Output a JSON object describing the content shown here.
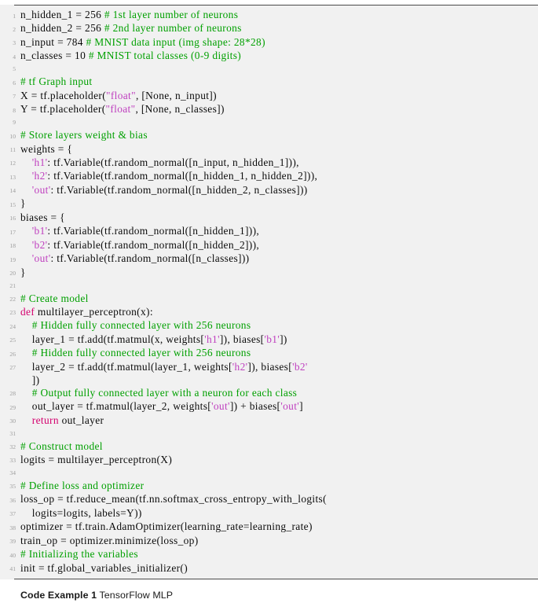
{
  "figure": {
    "kind": "code-listing",
    "language": "python",
    "background_color": "#f1f1f1",
    "rule_color": "#4a4a4a",
    "line_number_color": "#9a9a9a",
    "colors": {
      "comment": "#00a000",
      "string": "#bf3fbf",
      "keyword": "#d4006e",
      "plain": "#0b0b0b"
    }
  },
  "caption": {
    "label": "Code Example 1",
    "text": "TensorFlow MLP"
  },
  "code": {
    "lines": [
      {
        "n": "1",
        "tokens": [
          {
            "t": "txt",
            "s": "n_hidden_1 = 256 "
          },
          {
            "t": "com",
            "s": "# 1st layer number of neurons"
          }
        ]
      },
      {
        "n": "2",
        "tokens": [
          {
            "t": "txt",
            "s": "n_hidden_2 = 256 "
          },
          {
            "t": "com",
            "s": "# 2nd layer number of neurons"
          }
        ]
      },
      {
        "n": "3",
        "tokens": [
          {
            "t": "txt",
            "s": "n_input = 784 "
          },
          {
            "t": "com",
            "s": "# MNIST data input (img shape: 28*28)"
          }
        ]
      },
      {
        "n": "4",
        "tokens": [
          {
            "t": "txt",
            "s": "n_classes = 10 "
          },
          {
            "t": "com",
            "s": "# MNIST total classes (0-9 digits)"
          }
        ]
      },
      {
        "n": "5",
        "tokens": [
          {
            "t": "txt",
            "s": ""
          }
        ]
      },
      {
        "n": "6",
        "tokens": [
          {
            "t": "com",
            "s": "# tf Graph input"
          }
        ]
      },
      {
        "n": "7",
        "tokens": [
          {
            "t": "txt",
            "s": "X = tf.placeholder("
          },
          {
            "t": "str",
            "s": "\"float\""
          },
          {
            "t": "txt",
            "s": ", [None, n_input])"
          }
        ]
      },
      {
        "n": "8",
        "tokens": [
          {
            "t": "txt",
            "s": "Y = tf.placeholder("
          },
          {
            "t": "str",
            "s": "\"float\""
          },
          {
            "t": "txt",
            "s": ", [None, n_classes])"
          }
        ]
      },
      {
        "n": "9",
        "tokens": [
          {
            "t": "txt",
            "s": ""
          }
        ]
      },
      {
        "n": "10",
        "tokens": [
          {
            "t": "com",
            "s": "# Store layers weight & bias"
          }
        ]
      },
      {
        "n": "11",
        "tokens": [
          {
            "t": "txt",
            "s": "weights = {"
          }
        ]
      },
      {
        "n": "12",
        "tokens": [
          {
            "t": "txt",
            "s": "    "
          },
          {
            "t": "str",
            "s": "'h1'"
          },
          {
            "t": "txt",
            "s": ": tf.Variable(tf.random_normal([n_input, n_hidden_1])),"
          }
        ]
      },
      {
        "n": "13",
        "tokens": [
          {
            "t": "txt",
            "s": "    "
          },
          {
            "t": "str",
            "s": "'h2'"
          },
          {
            "t": "txt",
            "s": ": tf.Variable(tf.random_normal([n_hidden_1, n_hidden_2])),"
          }
        ]
      },
      {
        "n": "14",
        "tokens": [
          {
            "t": "txt",
            "s": "    "
          },
          {
            "t": "str",
            "s": "'out'"
          },
          {
            "t": "txt",
            "s": ": tf.Variable(tf.random_normal([n_hidden_2, n_classes]))"
          }
        ]
      },
      {
        "n": "15",
        "tokens": [
          {
            "t": "txt",
            "s": "}"
          }
        ]
      },
      {
        "n": "16",
        "tokens": [
          {
            "t": "txt",
            "s": "biases = {"
          }
        ]
      },
      {
        "n": "17",
        "tokens": [
          {
            "t": "txt",
            "s": "    "
          },
          {
            "t": "str",
            "s": "'b1'"
          },
          {
            "t": "txt",
            "s": ": tf.Variable(tf.random_normal([n_hidden_1])),"
          }
        ]
      },
      {
        "n": "18",
        "tokens": [
          {
            "t": "txt",
            "s": "    "
          },
          {
            "t": "str",
            "s": "'b2'"
          },
          {
            "t": "txt",
            "s": ": tf.Variable(tf.random_normal([n_hidden_2])),"
          }
        ]
      },
      {
        "n": "19",
        "tokens": [
          {
            "t": "txt",
            "s": "    "
          },
          {
            "t": "str",
            "s": "'out'"
          },
          {
            "t": "txt",
            "s": ": tf.Variable(tf.random_normal([n_classes]))"
          }
        ]
      },
      {
        "n": "20",
        "tokens": [
          {
            "t": "txt",
            "s": "}"
          }
        ]
      },
      {
        "n": "21",
        "tokens": [
          {
            "t": "txt",
            "s": ""
          }
        ]
      },
      {
        "n": "22",
        "tokens": [
          {
            "t": "com",
            "s": "# Create model"
          }
        ]
      },
      {
        "n": "23",
        "tokens": [
          {
            "t": "kw",
            "s": "def"
          },
          {
            "t": "txt",
            "s": " multilayer_perceptron(x):"
          }
        ]
      },
      {
        "n": "24",
        "tokens": [
          {
            "t": "txt",
            "s": "    "
          },
          {
            "t": "com",
            "s": "# Hidden fully connected layer with 256 neurons"
          }
        ]
      },
      {
        "n": "25",
        "tokens": [
          {
            "t": "txt",
            "s": "    layer_1 = tf.add(tf.matmul(x, weights["
          },
          {
            "t": "str",
            "s": "'h1'"
          },
          {
            "t": "txt",
            "s": "]), biases["
          },
          {
            "t": "str",
            "s": "'b1'"
          },
          {
            "t": "txt",
            "s": "])"
          }
        ]
      },
      {
        "n": "26",
        "tokens": [
          {
            "t": "txt",
            "s": "    "
          },
          {
            "t": "com",
            "s": "# Hidden fully connected layer with 256 neurons"
          }
        ]
      },
      {
        "n": "27",
        "tokens": [
          {
            "t": "txt",
            "s": "    layer_2 = tf.add(tf.matmul(layer_1, weights["
          },
          {
            "t": "str",
            "s": "'h2'"
          },
          {
            "t": "txt",
            "s": "]), biases["
          },
          {
            "t": "str",
            "s": "'b2'"
          }
        ]
      },
      {
        "n": "",
        "tokens": [
          {
            "t": "txt",
            "s": "    ])"
          }
        ]
      },
      {
        "n": "28",
        "tokens": [
          {
            "t": "txt",
            "s": "    "
          },
          {
            "t": "com",
            "s": "# Output fully connected layer with a neuron for each class"
          }
        ]
      },
      {
        "n": "29",
        "tokens": [
          {
            "t": "txt",
            "s": "    out_layer = tf.matmul(layer_2, weights["
          },
          {
            "t": "str",
            "s": "'out'"
          },
          {
            "t": "txt",
            "s": "]) + biases["
          },
          {
            "t": "str",
            "s": "'out'"
          },
          {
            "t": "txt",
            "s": "]"
          }
        ]
      },
      {
        "n": "30",
        "tokens": [
          {
            "t": "txt",
            "s": "    "
          },
          {
            "t": "kw",
            "s": "return"
          },
          {
            "t": "txt",
            "s": " out_layer"
          }
        ]
      },
      {
        "n": "31",
        "tokens": [
          {
            "t": "txt",
            "s": ""
          }
        ]
      },
      {
        "n": "32",
        "tokens": [
          {
            "t": "com",
            "s": "# Construct model"
          }
        ]
      },
      {
        "n": "33",
        "tokens": [
          {
            "t": "txt",
            "s": "logits = multilayer_perceptron(X)"
          }
        ]
      },
      {
        "n": "34",
        "tokens": [
          {
            "t": "txt",
            "s": ""
          }
        ]
      },
      {
        "n": "35",
        "tokens": [
          {
            "t": "com",
            "s": "# Define loss and optimizer"
          }
        ]
      },
      {
        "n": "36",
        "tokens": [
          {
            "t": "txt",
            "s": "loss_op = tf.reduce_mean(tf.nn.softmax_cross_entropy_with_logits("
          }
        ]
      },
      {
        "n": "37",
        "tokens": [
          {
            "t": "txt",
            "s": "    logits=logits, labels=Y))"
          }
        ]
      },
      {
        "n": "38",
        "tokens": [
          {
            "t": "txt",
            "s": "optimizer = tf.train.AdamOptimizer(learning_rate=learning_rate)"
          }
        ]
      },
      {
        "n": "39",
        "tokens": [
          {
            "t": "txt",
            "s": "train_op = optimizer.minimize(loss_op)"
          }
        ]
      },
      {
        "n": "40",
        "tokens": [
          {
            "t": "com",
            "s": "# Initializing the variables"
          }
        ]
      },
      {
        "n": "41",
        "tokens": [
          {
            "t": "txt",
            "s": "init = tf.global_variables_initializer()"
          }
        ]
      }
    ]
  }
}
